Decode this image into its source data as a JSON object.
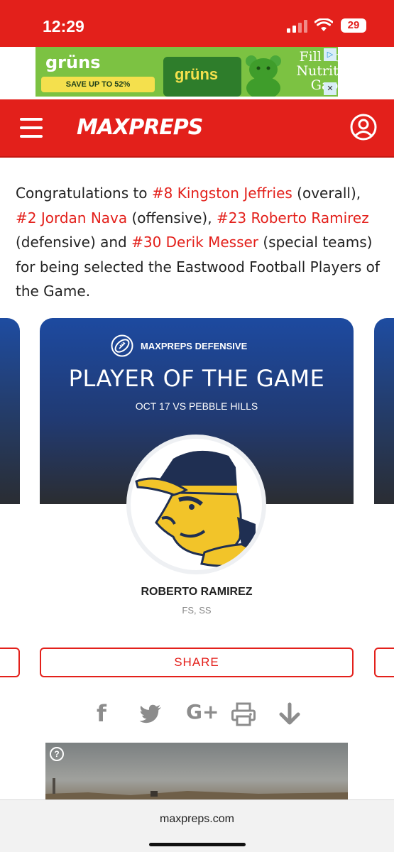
{
  "status_bar": {
    "time": "12:29",
    "battery": "29"
  },
  "ad": {
    "brand": "grüns",
    "badge": "SAVE UP TO 52%",
    "bag_text": "grüns",
    "headline": "Fill Your Nutrition Gaps",
    "ad_choice_icon": "info-icon",
    "close_icon": "close-icon"
  },
  "navbar": {
    "logo": "MAXPREPS",
    "menu_icon": "hamburger-icon",
    "account_icon": "user-icon"
  },
  "article": {
    "text_1": "Congratulations to ",
    "link_1": "#8 Kingston Jeffries",
    "text_2": " (overall), ",
    "link_2": "#2 Jordan Nava",
    "text_3": " (offensive), ",
    "link_3": "#23 Roberto Ramirez",
    "text_4": " (defensive) and ",
    "link_4": "#30 Derik Messer",
    "text_5": " (special teams) for being selected the Eastwood Football Players of the Game."
  },
  "card": {
    "tag": "MAXPREPS DEFENSIVE",
    "title": "PLAYER OF THE GAME",
    "subtitle": "OCT 17 VS PEBBLE HILLS",
    "player_name": "ROBERTO RAMIREZ",
    "positions": "FS, SS",
    "share_label": "SHARE"
  },
  "social_icons": [
    "facebook-icon",
    "twitter-icon",
    "google-plus-icon",
    "print-icon",
    "download-icon"
  ],
  "social_labels": {
    "facebook": "f",
    "googleplus": "G+"
  },
  "video": {
    "help_label": "?"
  },
  "url_bar": {
    "url": "maxpreps.com"
  },
  "colors": {
    "brand_red": "#e3201b",
    "card_blue": "#1d4aa0",
    "mascot_yellow": "#f2c429",
    "mascot_navy": "#1f2f52"
  }
}
